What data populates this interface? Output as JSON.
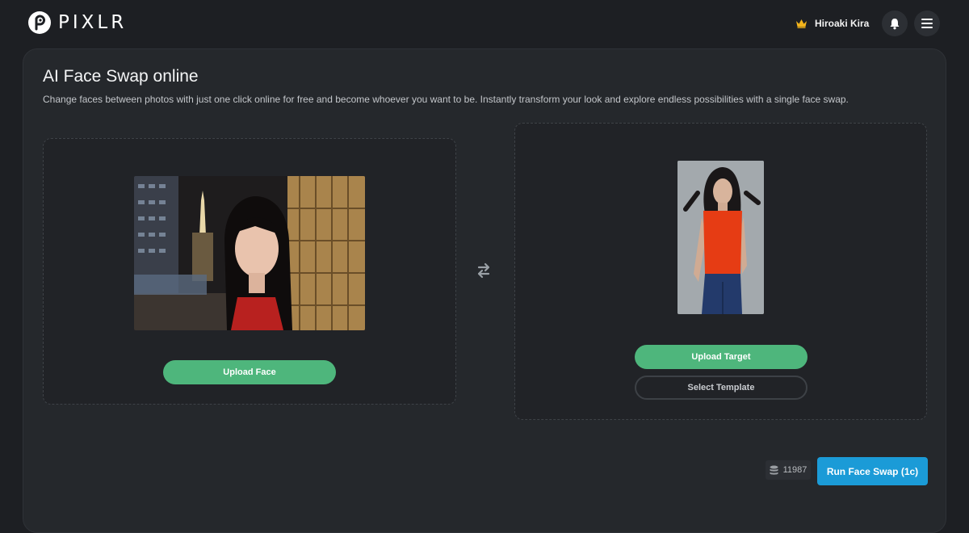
{
  "header": {
    "logo_text": "PIXLR",
    "user_name": "Hiroaki Kira",
    "icons": {
      "logo": "pixlr-logo-icon",
      "crown": "crown-icon",
      "bell": "bell-icon",
      "menu": "hamburger-menu-icon"
    }
  },
  "main": {
    "title": "AI Face Swap online",
    "subtitle": "Change faces between photos with just one click online for free and become whoever you want to be. Instantly transform your look and explore endless possibilities with a single face swap.",
    "face_panel": {
      "upload_label": "Upload Face"
    },
    "target_panel": {
      "upload_label": "Upload Target",
      "template_label": "Select Template"
    },
    "swap_icon": "swap-arrows-icon",
    "credits": {
      "icon": "coins-icon",
      "value": "11987"
    },
    "run_button_label": "Run Face Swap (1c)"
  },
  "colors": {
    "background": "#1d1f23",
    "card": "#25282c",
    "green_button": "#4eb67c",
    "run_button": "#1b9bd7",
    "crown": "#f2b31b"
  }
}
